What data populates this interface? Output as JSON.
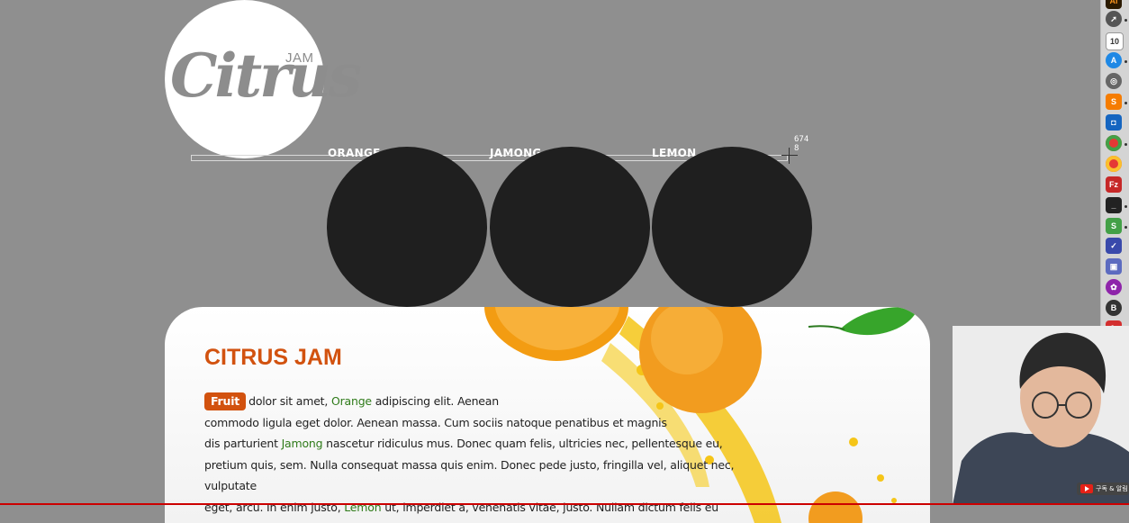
{
  "logo": {
    "jam": "JAM",
    "brand": "Citrus"
  },
  "nav": {
    "items": [
      {
        "label": "ORANGE"
      },
      {
        "label": "JAMONG"
      },
      {
        "label": "LEMON"
      }
    ],
    "measure": {
      "w": "674",
      "h": "8"
    }
  },
  "content": {
    "title": "CITRUS JAM",
    "badge": "Fruit",
    "p1a": "dolor sit amet, ",
    "hl1": "Orange",
    "p1b": " adipiscing elit. Aenean",
    "line2": "commodo ligula eget dolor. Aenean massa. Cum sociis natoque penatibus et magnis",
    "p3a": "dis parturient ",
    "hl2": "Jamong",
    "p3b": " nascetur ridiculus mus. Donec quam felis, ultricies nec, pellentesque eu,",
    "line4": "pretium quis, sem. Nulla consequat massa quis enim. Donec pede justo, fringilla vel, aliquet nec, vulputate",
    "p5a": "eget, arcu. In enim justo, ",
    "hl3": "Lemon",
    "p5b": " ut, imperdiet a, venenatis vitae, justo. Nullam dictum felis eu pede"
  },
  "dock": {
    "icons": [
      "illustrator-icon",
      "rocket-icon",
      "calendar-icon",
      "app-store-icon",
      "disk-utility-icon",
      "sublime-icon",
      "sourcetree-icon",
      "chrome-icon",
      "chrome-icon",
      "filezilla-icon",
      "terminal-icon",
      "sketch-icon",
      "task-icon",
      "screenshot-icon",
      "photos-icon",
      "blender-icon",
      "acrobat-icon",
      "chrome-icon"
    ],
    "calendar_day": "10"
  },
  "overlay": {
    "yt_text": "구독 & 알림"
  },
  "colors": {
    "accent": "#d2520f",
    "highlight": "#2f7b1a",
    "background": "#8f8f8f",
    "circle": "#1f1f1f"
  }
}
